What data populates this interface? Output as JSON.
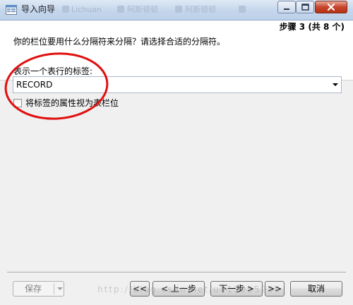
{
  "window": {
    "title": "导入向导",
    "ghost_titles": [
      "Lichuan",
      "阿斯顿顿",
      "阿斯顿顿"
    ]
  },
  "header": {
    "step": "步骤 3 (共 8 个)",
    "question": "你的栏位要用什么分隔符来分隔？请选择合适的分隔符。"
  },
  "form": {
    "record_tag_label": "表示一个表行的标签:",
    "record_tag_value": "RECORD",
    "attribute_checkbox_label": "将标签的属性视为表栏位",
    "attribute_checkbox_checked": false
  },
  "footer": {
    "save_label": "保存",
    "first_label": "<<",
    "prev_label": "< 上一步",
    "next_label": "下一步 >",
    "last_label": ">>",
    "cancel_label": "取消"
  },
  "watermark": "http://blog.csdn.net/u011055230",
  "colors": {
    "annotation": "#e01010",
    "titlebar": "#c4d6ec",
    "close_button": "#c7452b"
  },
  "icons": {
    "app": "import-wizard-icon",
    "minimize": "minimize-icon",
    "maximize": "maximize-icon",
    "close": "close-icon"
  }
}
